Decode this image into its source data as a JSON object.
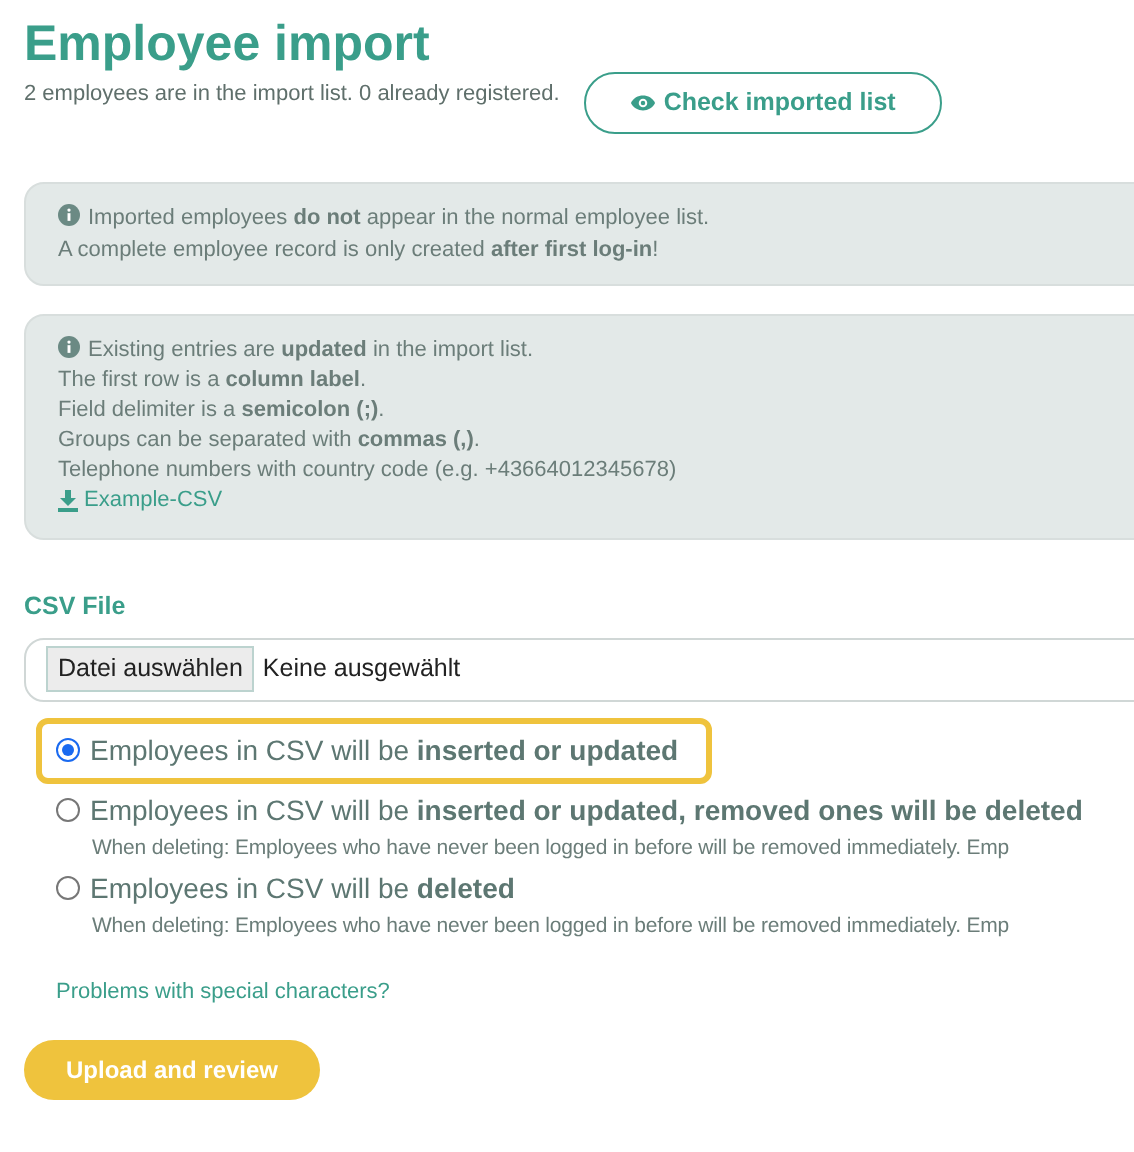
{
  "title": "Employee import",
  "summary": "2 employees are in the import list. 0 already registered.",
  "check_button": "Check imported list",
  "notice": [
    "Imported employees **do not** appear in the normal employee list.",
    "A complete employee record is only created **after first log-in**!"
  ],
  "instructions": [
    "Existing entries are **updated** in the import list.",
    "The first row is a **column label**.",
    "Field delimiter is a **semicolon (;)**.",
    "Groups can be separated with **commas (,)**.",
    "Telephone numbers with country code (e.g. +43664012345678)"
  ],
  "example_link": "Example-CSV",
  "csv_file": {
    "label": "CSV File",
    "button": "Datei auswählen",
    "value": "Keine ausgewählt"
  },
  "modes": [
    {
      "label": "Employees in CSV will be **inserted or updated**",
      "selected": true
    },
    {
      "label": "Employees in CSV will be **inserted or updated, removed ones will be deleted**",
      "selected": false,
      "hint": "When deleting: Employees who have never been logged in before will be removed immediately. Emp"
    },
    {
      "label": "Employees in CSV will be **deleted**",
      "selected": false,
      "hint": "When deleting: Employees who have never been logged in before will be removed immediately. Emp"
    }
  ],
  "help_link": "Problems with special characters?",
  "upload_button": "Upload and review"
}
